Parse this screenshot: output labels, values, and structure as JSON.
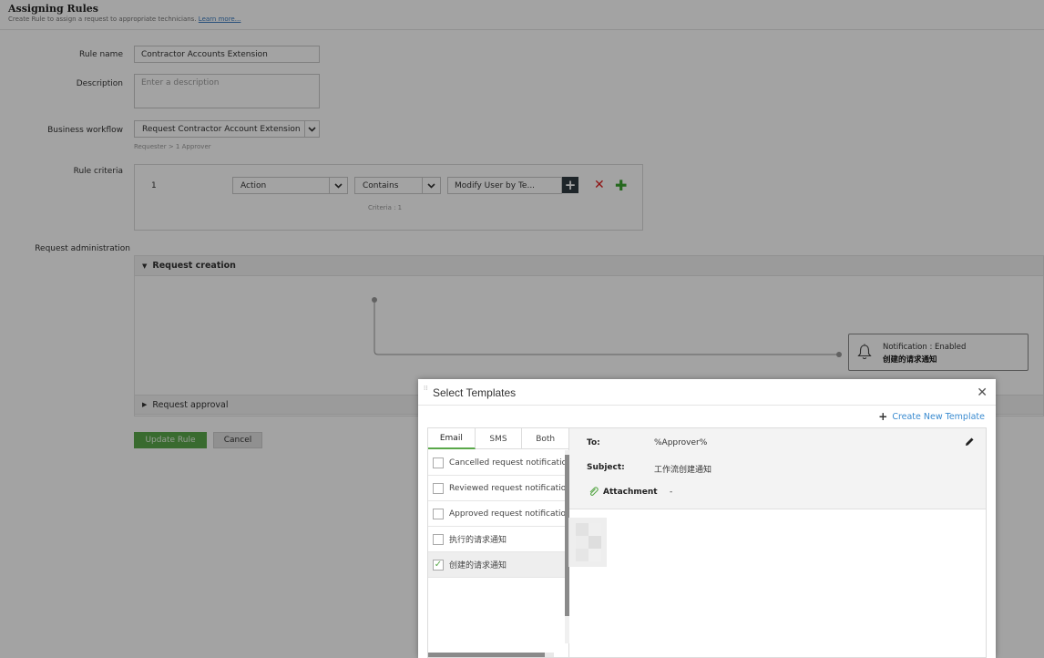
{
  "header": {
    "title": "Assigning Rules",
    "subtitle": "Create Rule to assign a request to appropriate technicians.",
    "learn_more": "Learn more..."
  },
  "form": {
    "rule_name_label": "Rule name",
    "rule_name_value": "Contractor Accounts Extension",
    "description_label": "Description",
    "description_placeholder": "Enter a description",
    "workflow_label": "Business workflow",
    "workflow_value": "Request Contractor Account Extension",
    "workflow_note": "Requester > 1 Approver",
    "criteria_label": "Rule criteria",
    "criteria": {
      "row_number": "1",
      "field": "Action",
      "operator": "Contains",
      "value": "Modify User by Te...",
      "count_note": "Criteria : 1"
    },
    "admin_label": "Request administration"
  },
  "admin": {
    "creation_label": "Request creation",
    "approval_label": "Request approval",
    "notification_status": "Notification : Enabled",
    "notification_name": "创建的请求通知"
  },
  "buttons": {
    "update": "Update Rule",
    "cancel": "Cancel"
  },
  "modal": {
    "title": "Select Templates",
    "create_new": "Create New Template",
    "tabs": [
      "Email",
      "SMS",
      "Both"
    ],
    "active_tab": "Email",
    "templates": [
      {
        "label": "Cancelled request notification",
        "checked": false
      },
      {
        "label": "Reviewed request notification",
        "checked": false
      },
      {
        "label": "Approved request notification",
        "checked": false
      },
      {
        "label": "执行的请求通知",
        "checked": false
      },
      {
        "label": "创建的请求通知",
        "checked": true
      }
    ],
    "preview": {
      "to_label": "To:",
      "to_value": "%Approver%",
      "subject_label": "Subject:",
      "subject_value": "工作流创建通知",
      "attachment_label": "Attachment",
      "attachment_value": "-"
    }
  },
  "colors": {
    "accent_green": "#5aa84a",
    "link_blue": "#3a8bd0",
    "delete_red": "#e02020"
  }
}
